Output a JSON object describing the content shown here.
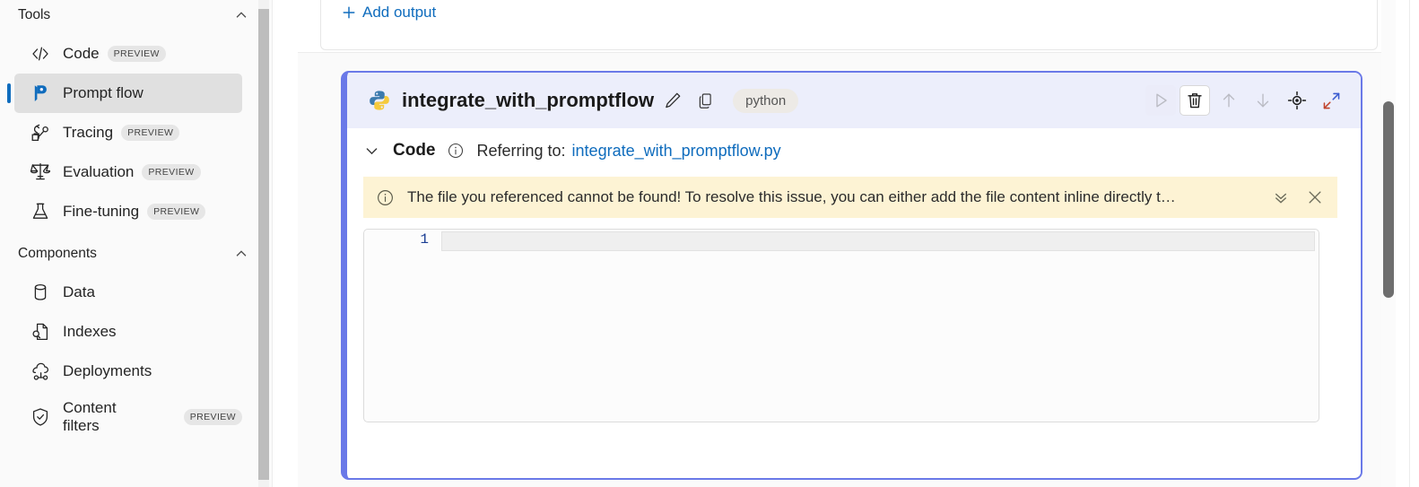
{
  "sidebar": {
    "sections": [
      {
        "title": "Tools",
        "collapse_icon": "chevron-up-icon",
        "items": [
          {
            "label": "Code",
            "icon": "code-brackets-icon",
            "badge": "PREVIEW",
            "selected": false
          },
          {
            "label": "Prompt flow",
            "icon": "promptflow-flag-icon",
            "badge": "",
            "selected": true
          },
          {
            "label": "Tracing",
            "icon": "tracing-icon",
            "badge": "PREVIEW",
            "selected": false
          },
          {
            "label": "Evaluation",
            "icon": "scales-icon",
            "badge": "PREVIEW",
            "selected": false
          },
          {
            "label": "Fine-tuning",
            "icon": "flask-icon",
            "badge": "PREVIEW",
            "selected": false
          }
        ]
      },
      {
        "title": "Components",
        "collapse_icon": "chevron-up-icon",
        "items": [
          {
            "label": "Data",
            "icon": "database-icon",
            "badge": "",
            "selected": false
          },
          {
            "label": "Indexes",
            "icon": "document-search-icon",
            "badge": "",
            "selected": false
          },
          {
            "label": "Deployments",
            "icon": "cloud-deploy-icon",
            "badge": "",
            "selected": false
          },
          {
            "label": "Content filters",
            "icon": "shield-check-icon",
            "badge": "PREVIEW",
            "selected": false
          }
        ]
      }
    ]
  },
  "top_panel": {
    "add_output_label": "Add output",
    "add_output_icon": "plus-icon"
  },
  "node": {
    "language_icon": "python-logo-icon",
    "title": "integrate_with_promptflow",
    "edit_icon": "pencil-icon",
    "copy_icon": "copy-icon",
    "language_badge": "python",
    "toolbar": [
      {
        "name": "run-button",
        "icon": "play-icon",
        "enabled": false
      },
      {
        "name": "delete-button",
        "icon": "trash-icon",
        "enabled": true
      },
      {
        "name": "move-up-button",
        "icon": "arrow-up-icon",
        "enabled": false
      },
      {
        "name": "move-down-button",
        "icon": "arrow-down-icon",
        "enabled": false
      },
      {
        "name": "locate-button",
        "icon": "target-locate-icon",
        "enabled": true
      },
      {
        "name": "expand-button",
        "icon": "expand-diagonal-icon",
        "enabled": true
      }
    ],
    "code_section": {
      "collapse_icon": "chevron-down-icon",
      "label": "Code",
      "info_icon": "info-circle-icon",
      "referring_prefix": "Referring to:",
      "referring_file": "integrate_with_promptflow.py"
    },
    "warning": {
      "icon": "info-circle-icon",
      "text": "The file you referenced cannot be found! To resolve this issue, you can either add the file content inline directly t…",
      "expand_icon": "double-chevron-down-icon",
      "close_icon": "close-icon"
    },
    "editor": {
      "lines": [
        {
          "number": "1",
          "text": ""
        }
      ]
    }
  },
  "colors": {
    "accent_blue": "#0f6cbd",
    "node_border": "#6a79e8",
    "node_header_bg": "#eceefb",
    "warning_bg": "#fdf3d4",
    "selected_item_bg": "#e0e0e0"
  }
}
